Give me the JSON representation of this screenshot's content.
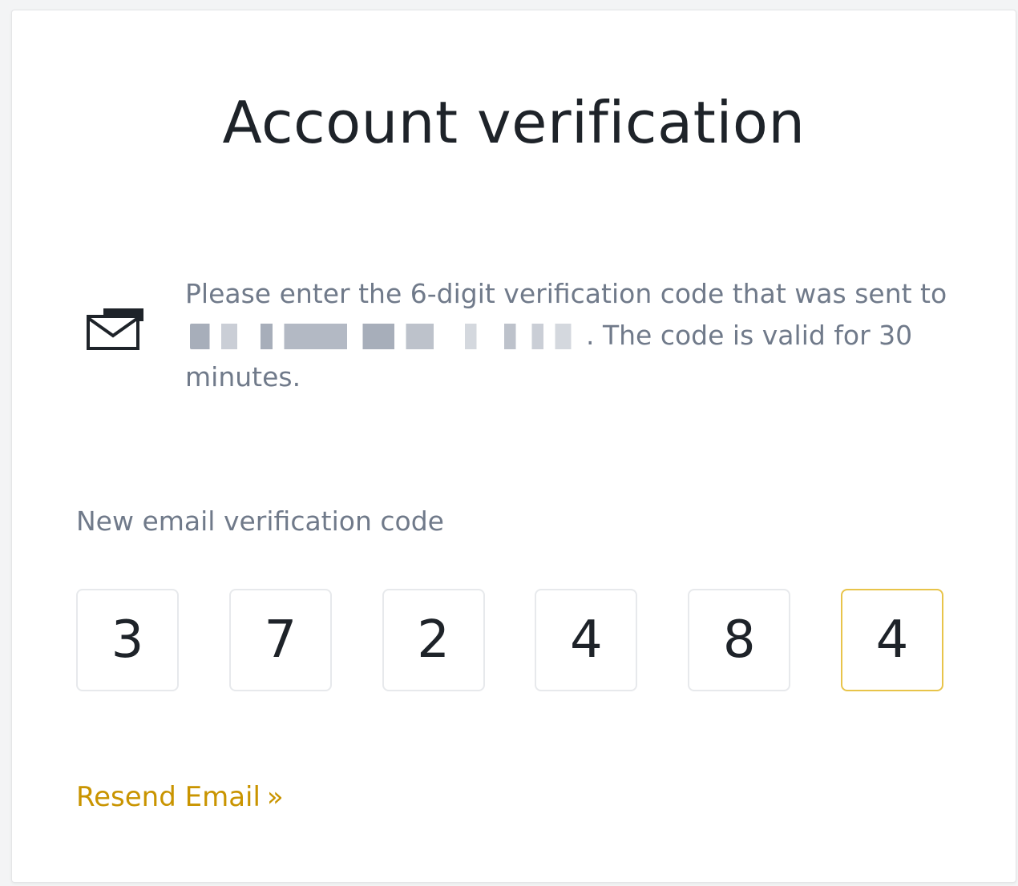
{
  "title": "Account verification",
  "info": {
    "text_before": "Please enter the 6-digit verification code that was sent to",
    "text_after": ". The code is valid for 30 minutes."
  },
  "code_label": "New email verification code",
  "code_digits": [
    "3",
    "7",
    "2",
    "4",
    "8",
    "4"
  ],
  "resend": {
    "label": "Resend Email",
    "icon": "»"
  },
  "colors": {
    "accent": "#c99400",
    "active_border": "#e8c44a",
    "text_primary": "#1e2329",
    "text_secondary": "#707a8a"
  }
}
